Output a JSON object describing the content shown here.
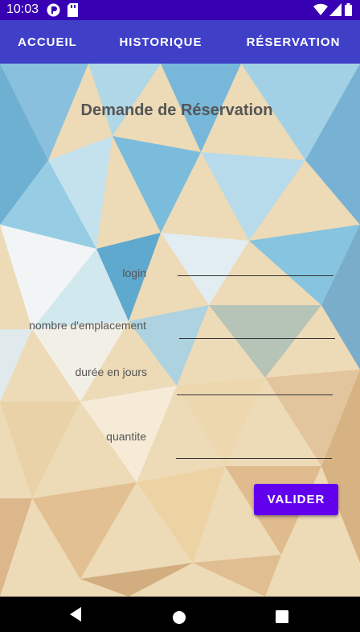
{
  "status_bar": {
    "time": "10:03",
    "left_icons": [
      "app-icon",
      "sd-card-icon"
    ],
    "right_icons": [
      "wifi-icon",
      "signal-icon",
      "battery-icon"
    ]
  },
  "tabs": [
    {
      "label": "ACCUEIL"
    },
    {
      "label": "HISTORIQUE"
    },
    {
      "label": "RÉSERVATION"
    }
  ],
  "form": {
    "title": "Demande de Réservation",
    "fields": [
      {
        "label": "login",
        "value": ""
      },
      {
        "label": "nombre d'emplacement",
        "value": ""
      },
      {
        "label": "durée en jours",
        "value": ""
      },
      {
        "label": "quantite",
        "value": ""
      }
    ],
    "submit_label": "VALIDER"
  },
  "colors": {
    "status_bar": "#3700B3",
    "tab_bar": "#3F3FC8",
    "button": "#6200EE"
  },
  "nav_bar": {
    "icons": [
      "back-icon",
      "home-icon",
      "recents-icon"
    ]
  }
}
